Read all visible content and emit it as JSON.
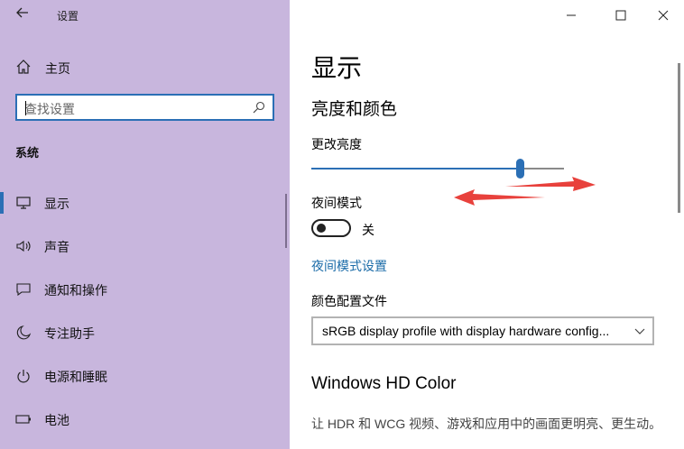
{
  "app": {
    "title": "设置",
    "back_icon": "back-arrow-icon"
  },
  "window": {
    "buttons": [
      "minimize-icon",
      "maximize-icon",
      "close-icon"
    ]
  },
  "sidebar": {
    "home_label": "主页",
    "search_placeholder": "查找设置",
    "section": "系统",
    "items": [
      {
        "label": "显示",
        "icon": "monitor-icon",
        "active": true
      },
      {
        "label": "声音",
        "icon": "speaker-icon",
        "active": false
      },
      {
        "label": "通知和操作",
        "icon": "notification-icon",
        "active": false
      },
      {
        "label": "专注助手",
        "icon": "moon-icon",
        "active": false
      },
      {
        "label": "电源和睡眠",
        "icon": "power-icon",
        "active": false
      },
      {
        "label": "电池",
        "icon": "battery-icon",
        "active": false
      }
    ],
    "accent": "#c8b6dd"
  },
  "main": {
    "page_title": "显示",
    "brightness_group": "亮度和颜色",
    "brightness_label": "更改亮度",
    "brightness_value": 0.83,
    "night_mode_label": "夜间模式",
    "night_mode_state": "关",
    "night_mode_link": "夜间模式设置",
    "color_profile_label": "颜色配置文件",
    "color_profile_value": "sRGB display profile with display hardware config...",
    "hd_title": "Windows HD Color",
    "hd_desc": "让 HDR 和 WCG 视频、游戏和应用中的画面更明亮、更生动。"
  },
  "colors": {
    "accent_blue": "#2b6fb5",
    "link": "#1a6ba8",
    "annotation_red": "#e8413c"
  }
}
